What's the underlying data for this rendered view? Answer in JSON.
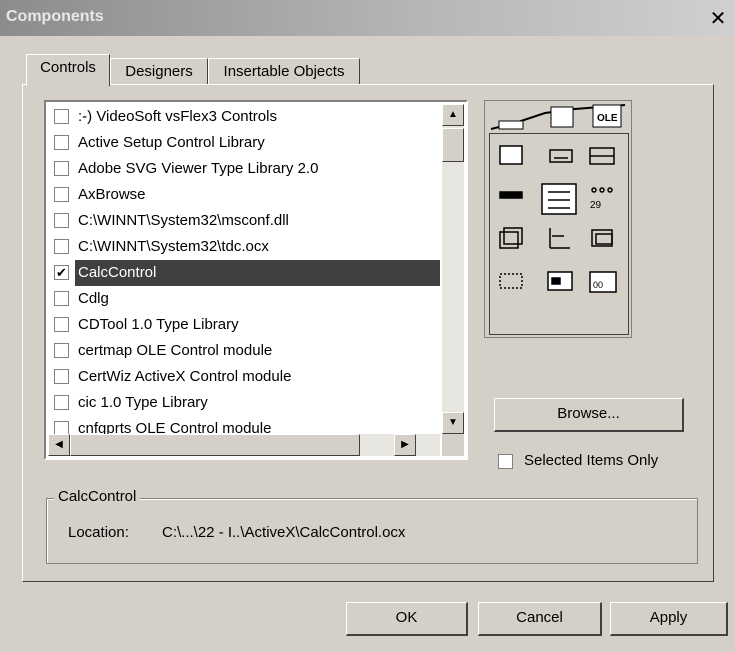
{
  "window": {
    "title": "Components",
    "close_glyph": "✕"
  },
  "tabs": [
    {
      "label": "Controls",
      "active": true
    },
    {
      "label": "Designers",
      "active": false
    },
    {
      "label": "Insertable Objects",
      "active": false
    }
  ],
  "components": [
    {
      "label": ":-) VideoSoft vsFlex3 Controls",
      "checked": false
    },
    {
      "label": "Active Setup Control Library",
      "checked": false
    },
    {
      "label": "Adobe SVG Viewer Type Library 2.0",
      "checked": false
    },
    {
      "label": "AxBrowse",
      "checked": false
    },
    {
      "label": "C:\\WINNT\\System32\\msconf.dll",
      "checked": false
    },
    {
      "label": "C:\\WINNT\\System32\\tdc.ocx",
      "checked": false
    },
    {
      "label": "CalcControl",
      "checked": true,
      "selected": true
    },
    {
      "label": "Cdlg",
      "checked": false
    },
    {
      "label": "CDTool 1.0 Type Library",
      "checked": false
    },
    {
      "label": "certmap OLE Control module",
      "checked": false
    },
    {
      "label": "CertWiz ActiveX Control module",
      "checked": false
    },
    {
      "label": "cic 1.0 Type Library",
      "checked": false
    },
    {
      "label": "cnfgprts OLE Control module",
      "checked": false
    }
  ],
  "browse_button": {
    "label": "Browse..."
  },
  "selected_only": {
    "label": "Selected Items Only",
    "checked": false
  },
  "details": {
    "group_title": "CalcControl",
    "location_label": "Location:",
    "location_value": "C:\\...\\22 - I..\\ActiveX\\CalcControl.ocx"
  },
  "buttons": {
    "ok": "OK",
    "cancel": "Cancel",
    "apply": "Apply"
  }
}
